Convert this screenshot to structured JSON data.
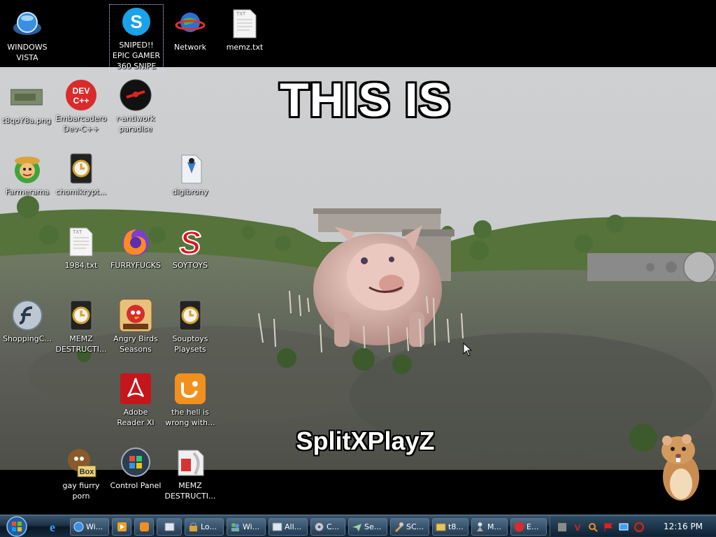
{
  "wallpaper": {
    "top_text": "THIS IS",
    "bottom_text": "SplitXPlayZ"
  },
  "desktop_icons": [
    {
      "label": "WINDOWS VISTA",
      "icon": "vista-orb-icon"
    },
    {
      "label": "SNIPED!! EPIC GAMER 360 SNIPE",
      "icon": "skype-icon",
      "selected": true
    },
    {
      "label": "Network",
      "icon": "network-globe-icon"
    },
    {
      "label": "memz.txt",
      "icon": "text-file-icon"
    },
    {
      "label": "t8qoY8a.png",
      "icon": "image-file-icon"
    },
    {
      "label": "Embarcadero Dev-C++",
      "icon": "devcpp-icon"
    },
    {
      "label": "r-antiwork paradise",
      "icon": "red-eye-icon"
    },
    {
      "label": "Farmerama",
      "icon": "farmer-icon"
    },
    {
      "label": "chomikrypt...",
      "icon": "clock-shortcut-icon"
    },
    {
      "label": "digibrony",
      "icon": "figure-icon"
    },
    {
      "label": "1984.txt",
      "icon": "text-file-icon"
    },
    {
      "label": "FURRYFUCKS",
      "icon": "firefox-icon"
    },
    {
      "label": "SOYTOYS",
      "icon": "s-logo-icon"
    },
    {
      "label": "ShoppingC...",
      "icon": "flash-icon"
    },
    {
      "label": "MEMZ DESTRUCTI...",
      "icon": "clock-shortcut-icon"
    },
    {
      "label": "Angry Birds Seasons",
      "icon": "angry-birds-icon"
    },
    {
      "label": "Souptoys Playsets",
      "icon": "clock-shortcut-icon"
    },
    {
      "label": "Adobe Reader XI",
      "icon": "adobe-reader-icon"
    },
    {
      "label": "the hell is wrong with...",
      "icon": "uc-browser-icon"
    },
    {
      "label": "gay fiurry porn",
      "icon": "box-animal-icon"
    },
    {
      "label": "Control Panel",
      "icon": "control-panel-icon"
    },
    {
      "label": "MEMZ DESTRUCTI...",
      "icon": "memz-icon"
    }
  ],
  "taskbar": {
    "buttons": [
      {
        "label": "Wi...",
        "icon": "vista-orb-icon"
      },
      {
        "label": "",
        "icon": "media-icon"
      },
      {
        "label": "",
        "icon": "uc-browser-icon"
      },
      {
        "label": "",
        "icon": "window-icon"
      },
      {
        "label": "Lo...",
        "icon": "lock-icon"
      },
      {
        "label": "Wi...",
        "icon": "users-icon"
      },
      {
        "label": "All...",
        "icon": "window-icon"
      },
      {
        "label": "C...",
        "icon": "disk-icon"
      },
      {
        "label": "Se...",
        "icon": "plane-icon"
      },
      {
        "label": "SC...",
        "icon": "tool-icon"
      },
      {
        "label": "t8...",
        "icon": "folder-icon"
      },
      {
        "label": "M...",
        "icon": "figure-icon"
      },
      {
        "label": "E...",
        "icon": "devcpp-icon"
      }
    ],
    "clock": "12:16 PM"
  }
}
